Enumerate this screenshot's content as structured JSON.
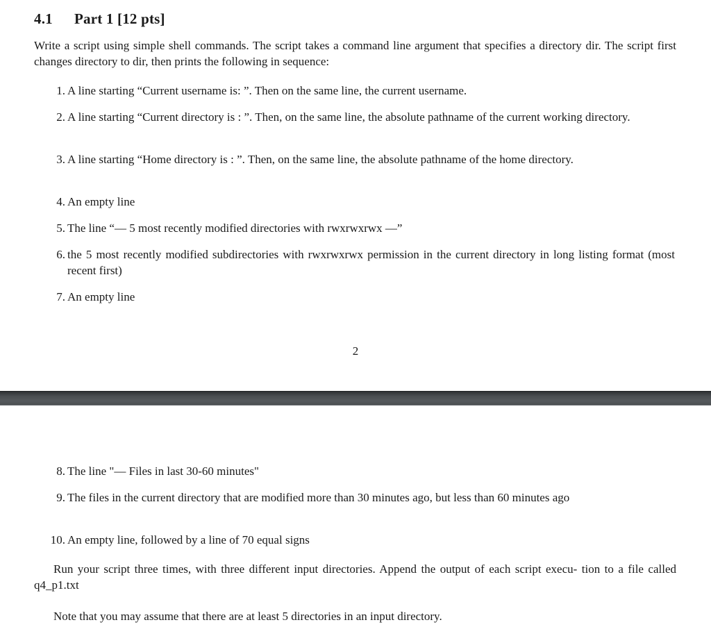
{
  "section": {
    "number": "4.1",
    "title": "Part 1 [12 pts]"
  },
  "intro": "Write a script using simple shell commands. The script takes a command line argument that specifies a directory dir. The script first changes directory to dir, then prints the following in sequence:",
  "items": [
    {
      "n": "1.",
      "text": "A line starting “Current username is: ”. Then on the same line, the current username."
    },
    {
      "n": "2.",
      "text": "A line starting “Current directory is : ”. Then, on the same line, the absolute pathname of the current working directory."
    },
    {
      "n": "3.",
      "text": "A line starting “Home directory is : ”. Then, on the same line, the absolute pathname of the home directory."
    },
    {
      "n": "4.",
      "text": "An empty line"
    },
    {
      "n": "5.",
      "text": "The line “— 5 most recently modified directories with rwxrwxrwx —”"
    },
    {
      "n": "6.",
      "text": "the 5 most recently modified subdirectories with rwxrwxrwx permission in the current directory in long listing format (most recent first)"
    },
    {
      "n": "7.",
      "text": "An empty line"
    },
    {
      "n": "8.",
      "text": "The line \"— Files in last 30-60 minutes\""
    },
    {
      "n": "9.",
      "text": "The files in the current directory that are modified more than 30 minutes ago, but less than 60 minutes ago"
    },
    {
      "n": "10.",
      "text": "An empty line, followed by a line of 70 equal signs"
    }
  ],
  "page_number": "2",
  "run_paragraph": "Run your script three times, with three different input directories. Append the output of each script execu- tion to a file called q4_p1.txt",
  "note": "Note that you may assume that there are at least 5 directories in an input directory."
}
